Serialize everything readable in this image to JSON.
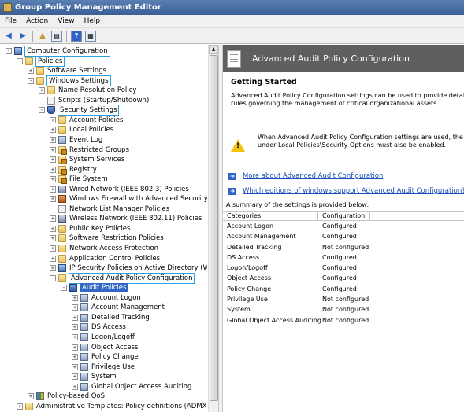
{
  "window": {
    "title": "Group Policy Management Editor"
  },
  "menu": [
    "File",
    "Action",
    "View",
    "Help"
  ],
  "tree": [
    {
      "label": "Computer Configuration",
      "indent": 0,
      "exp": "-",
      "icon": "computer",
      "hl": true
    },
    {
      "label": "Policies",
      "indent": 1,
      "exp": "-",
      "icon": "folder",
      "hl": true
    },
    {
      "label": "Software Settings",
      "indent": 2,
      "exp": "+",
      "icon": "folder"
    },
    {
      "label": "Windows Settings",
      "indent": 2,
      "exp": "-",
      "icon": "folder",
      "hl": true
    },
    {
      "label": "Name Resolution Policy",
      "indent": 3,
      "exp": "+",
      "icon": "folder"
    },
    {
      "label": "Scripts (Startup/Shutdown)",
      "indent": 3,
      "exp": "",
      "icon": "doc"
    },
    {
      "label": "Security Settings",
      "indent": 3,
      "exp": "-",
      "icon": "shield",
      "hl": true
    },
    {
      "label": "Account Policies",
      "indent": 4,
      "exp": "+",
      "icon": "folder"
    },
    {
      "label": "Local Policies",
      "indent": 4,
      "exp": "+",
      "icon": "folder"
    },
    {
      "label": "Event Log",
      "indent": 4,
      "exp": "+",
      "icon": "policy"
    },
    {
      "label": "Restricted Groups",
      "indent": 4,
      "exp": "+",
      "icon": "lockfolder"
    },
    {
      "label": "System Services",
      "indent": 4,
      "exp": "+",
      "icon": "lockfolder"
    },
    {
      "label": "Registry",
      "indent": 4,
      "exp": "+",
      "icon": "lockfolder"
    },
    {
      "label": "File System",
      "indent": 4,
      "exp": "+",
      "icon": "lockfolder"
    },
    {
      "label": "Wired Network (IEEE 802.3) Policies",
      "indent": 4,
      "exp": "+",
      "icon": "network"
    },
    {
      "label": "Windows Firewall with Advanced Security",
      "indent": 4,
      "exp": "+",
      "icon": "firewall"
    },
    {
      "label": "Network List Manager Policies",
      "indent": 4,
      "exp": "",
      "icon": "doc"
    },
    {
      "label": "Wireless Network (IEEE 802.11) Policies",
      "indent": 4,
      "exp": "+",
      "icon": "network"
    },
    {
      "label": "Public Key Policies",
      "indent": 4,
      "exp": "+",
      "icon": "folder"
    },
    {
      "label": "Software Restriction Policies",
      "indent": 4,
      "exp": "+",
      "icon": "folder"
    },
    {
      "label": "Network Access Protection",
      "indent": 4,
      "exp": "+",
      "icon": "folder"
    },
    {
      "label": "Application Control Policies",
      "indent": 4,
      "exp": "+",
      "icon": "folder"
    },
    {
      "label": "IP Security Policies on Active Directory (WW",
      "indent": 4,
      "exp": "+",
      "icon": "computer"
    },
    {
      "label": "Advanced Audit Policy Configuration",
      "indent": 4,
      "exp": "-",
      "icon": "folder",
      "hl": true
    },
    {
      "label": "Audit Policies",
      "indent": 5,
      "exp": "-",
      "icon": "audit",
      "sel": true
    },
    {
      "label": "Account Logon",
      "indent": 6,
      "exp": "+",
      "icon": "policy"
    },
    {
      "label": "Account Management",
      "indent": 6,
      "exp": "+",
      "icon": "policy"
    },
    {
      "label": "Detailed Tracking",
      "indent": 6,
      "exp": "+",
      "icon": "policy"
    },
    {
      "label": "DS Access",
      "indent": 6,
      "exp": "+",
      "icon": "policy"
    },
    {
      "label": "Logon/Logoff",
      "indent": 6,
      "exp": "+",
      "icon": "policy"
    },
    {
      "label": "Object Access",
      "indent": 6,
      "exp": "+",
      "icon": "policy"
    },
    {
      "label": "Policy Change",
      "indent": 6,
      "exp": "+",
      "icon": "policy"
    },
    {
      "label": "Privilege Use",
      "indent": 6,
      "exp": "+",
      "icon": "policy"
    },
    {
      "label": "System",
      "indent": 6,
      "exp": "+",
      "icon": "policy"
    },
    {
      "label": "Global Object Access Auditing",
      "indent": 6,
      "exp": "+",
      "icon": "policy"
    },
    {
      "label": "Policy-based QoS",
      "indent": 2,
      "exp": "+",
      "icon": "chart"
    },
    {
      "label": "Administrative Templates: Policy definitions (ADMX fil",
      "indent": 1,
      "exp": "+",
      "icon": "folder"
    }
  ],
  "right": {
    "banner_title": "Advanced Audit Policy Configuration",
    "getting_started": "Getting Started",
    "body_line1": "Advanced Audit Policy Configuration settings can be used to provide detailed c",
    "body_line2": "rules governing the management of critical organizational assets.",
    "warn_line1": "When Advanced Audit Policy Configuration settings are used, the \"Au",
    "warn_line2": "under Local Policies\\Security Options must also be enabled.",
    "link1": "More about Advanced Audit Configuration",
    "link2": "Which editions of windows support Advanced Audit Configuration?",
    "summary": "A summary of the settings is provided below:",
    "columns": [
      "Categories",
      "Configuration"
    ],
    "rows": [
      [
        "Account Logon",
        "Configured"
      ],
      [
        "Account Management",
        "Configured"
      ],
      [
        "Detailed Tracking",
        "Not configured"
      ],
      [
        "DS Access",
        "Configured"
      ],
      [
        "Logon/Logoff",
        "Configured"
      ],
      [
        "Object Access",
        "Configured"
      ],
      [
        "Policy Change",
        "Configured"
      ],
      [
        "Privilege Use",
        "Not configured"
      ],
      [
        "System",
        "Not configured"
      ],
      [
        "Global Object Access Auditing",
        "Not configured"
      ]
    ]
  }
}
